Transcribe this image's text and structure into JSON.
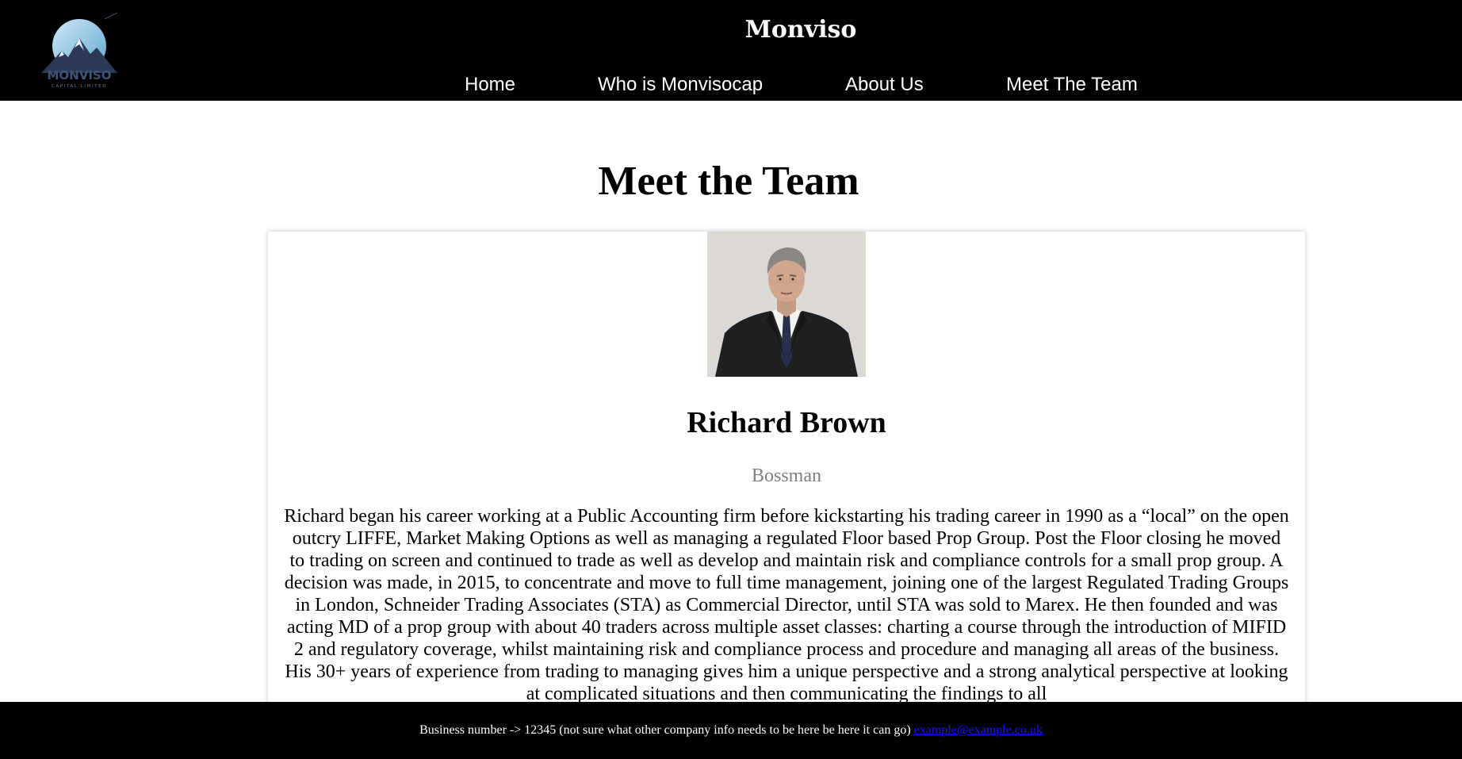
{
  "header": {
    "logo": {
      "text": "MONVISO",
      "subtext": "CAPITAL LIMITED"
    },
    "title": "Monviso",
    "nav": [
      {
        "label": "Home"
      },
      {
        "label": "Who is Monvisocap"
      },
      {
        "label": "About Us"
      },
      {
        "label": "Meet The Team"
      }
    ]
  },
  "main": {
    "heading": "Meet the Team",
    "member": {
      "name": "Richard Brown",
      "role": "Bossman",
      "bio": "Richard began his career working at a Public Accounting firm before kickstarting his trading career in 1990 as a “local” on the open outcry LIFFE, Market Making Options as well as managing a regulated Floor based Prop Group. Post the Floor closing he moved to trading on screen and continued to trade as well as develop and maintain risk and compliance controls for a small prop group. A decision was made, in 2015, to concentrate and move to full time management, joining one of the largest Regulated Trading Groups in London, Schneider Trading Associates (STA) as Commercial Director, until STA was sold to Marex. He then founded and was acting MD of a prop group with about 40 traders across multiple asset classes: charting a course through the introduction of MIFID 2 and regulatory coverage, whilst maintaining risk and compliance process and procedure and managing all areas of the business. His 30+ years of experience from trading to managing gives him a unique perspective and a strong analytical perspective at looking at complicated situations and then communicating the findings to all"
    }
  },
  "footer": {
    "text": "Business number -> 12345 (not sure what other company info needs to be here be here it can go)",
    "email": "example@example.co.uk"
  },
  "colors": {
    "header_bg": "#000000",
    "footer_bg": "#000000",
    "link": "#1a0dff",
    "role_text": "#808080"
  }
}
